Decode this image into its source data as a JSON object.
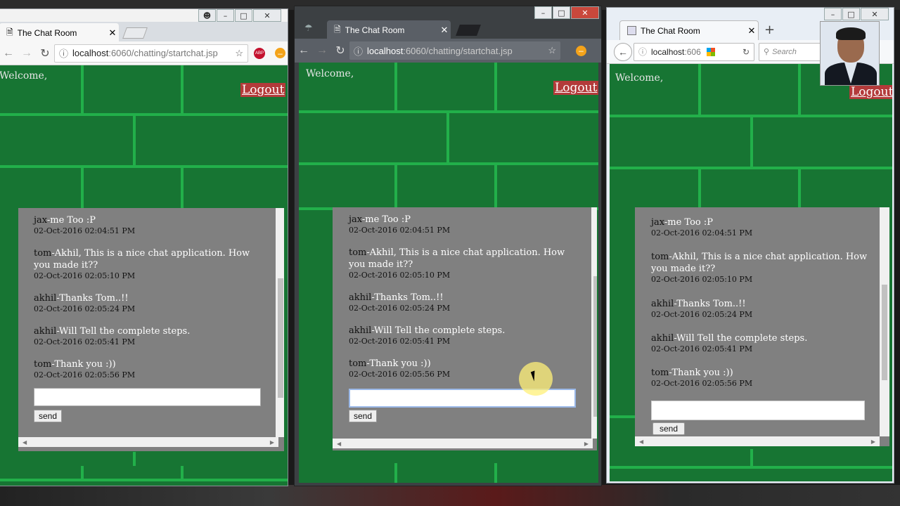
{
  "windows": [
    {
      "tab_title": "The Chat Room",
      "url_host": "localhost",
      "url_path": ":6060/chatting/startchat.jsp",
      "welcome": "Welcome,",
      "logout": "Logout",
      "send": "send"
    },
    {
      "tab_title": "The Chat Room",
      "url_host": "localhost",
      "url_path": ":6060/chatting/startchat.jsp",
      "welcome": "Welcome,",
      "logout": "Logout",
      "send": "send"
    },
    {
      "tab_title": "The Chat Room",
      "url_host": "localhost",
      "url_path": ":606",
      "search_placeholder": "Search",
      "welcome": "Welcome,",
      "logout": "Logout",
      "send": "send"
    }
  ],
  "messages": [
    {
      "user": "jax",
      "text": "-me Too :P",
      "time": "02-Oct-2016 02:04:51 PM"
    },
    {
      "user": "tom",
      "text": "-Akhil, This is a nice chat application. How you made it??",
      "time": "02-Oct-2016 02:05:10 PM"
    },
    {
      "user": "akhil",
      "text": "-Thanks Tom..!!",
      "time": "02-Oct-2016 02:05:24 PM"
    },
    {
      "user": "akhil",
      "text": "-Will Tell the complete steps.",
      "time": "02-Oct-2016 02:05:41 PM"
    },
    {
      "user": "tom",
      "text": "-Thank you :))",
      "time": "02-Oct-2016 02:05:56 PM"
    }
  ],
  "icons": {
    "abp": "ABP",
    "new_tab": "+"
  },
  "colors": {
    "page_bg": "#177533",
    "grid_line": "#22b04a",
    "chat_bg": "#808080",
    "logout_bg": "#b33a3a",
    "incognito_frame": "#3c4043"
  }
}
